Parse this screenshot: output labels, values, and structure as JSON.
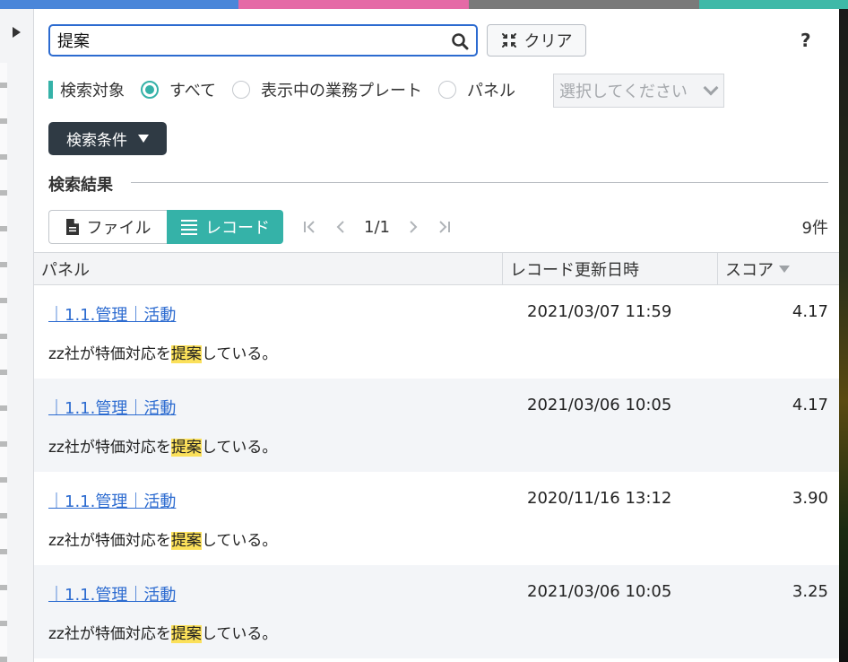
{
  "colors": {
    "accent_teal": "#35b2a8",
    "focus_blue": "#2c6bd0",
    "dark_button": "#2f3a44",
    "highlight": "#fbe05a",
    "stripe": [
      "#4a86d9",
      "#e56aa6",
      "#7a7a7a",
      "#3fb9a8"
    ]
  },
  "search": {
    "query": "提案",
    "clear_label": "クリア",
    "help_label": "?"
  },
  "target": {
    "label": "検索対象",
    "options": [
      "すべて",
      "表示中の業務プレート",
      "パネル"
    ],
    "selected": "すべて",
    "select_placeholder": "選択してください"
  },
  "conditions": {
    "label": "検索条件"
  },
  "results": {
    "title": "検索結果",
    "view_file_label": "ファイル",
    "view_record_label": "レコード",
    "page": "1/1",
    "count": "9件",
    "columns": [
      "パネル",
      "レコード更新日時",
      "スコア"
    ],
    "rows": [
      {
        "path": "｜1.1.管理｜活動",
        "date": "2021/03/07 11:59",
        "score": "4.17",
        "pre": "zz社が特価対応を",
        "hit": "提案",
        "post": "している。"
      },
      {
        "path": "｜1.1.管理｜活動",
        "date": "2021/03/06 10:05",
        "score": "4.17",
        "pre": "zz社が特価対応を",
        "hit": "提案",
        "post": "している。"
      },
      {
        "path": "｜1.1.管理｜活動",
        "date": "2020/11/16 13:12",
        "score": "3.90",
        "pre": "zz社が特価対応を",
        "hit": "提案",
        "post": "している。"
      },
      {
        "path": "｜1.1.管理｜活動",
        "date": "2021/03/06 10:05",
        "score": "3.25",
        "pre": "zz社が特価対応を",
        "hit": "提案",
        "post": "している。"
      }
    ]
  },
  "icons": [
    "expand-panel-icon",
    "search-icon",
    "collapse-arrows-icon",
    "help-icon",
    "dropdown-chevron-icon",
    "caret-down-icon",
    "file-icon",
    "list-icon",
    "first-page-icon",
    "prev-page-icon",
    "next-page-icon",
    "last-page-icon",
    "sort-desc-icon"
  ]
}
